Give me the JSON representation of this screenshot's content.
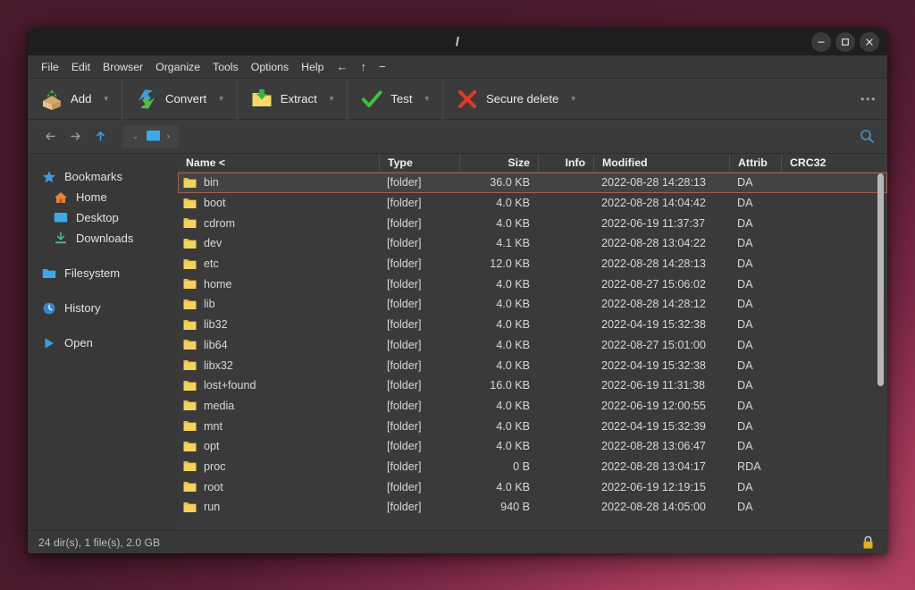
{
  "window": {
    "title": "/",
    "controls": [
      {
        "name": "minimize-button",
        "icon": "minimize-icon",
        "label": "Minimize"
      },
      {
        "name": "maximize-button",
        "icon": "maximize-icon",
        "label": "Maximize"
      },
      {
        "name": "close-button",
        "icon": "close-icon",
        "label": "Close"
      }
    ]
  },
  "menubar": {
    "items": [
      {
        "label": "File"
      },
      {
        "label": "Edit"
      },
      {
        "label": "Browser"
      },
      {
        "label": "Organize"
      },
      {
        "label": "Tools"
      },
      {
        "label": "Options"
      },
      {
        "label": "Help"
      }
    ],
    "icons": [
      {
        "name": "menu-back-icon",
        "glyph": "←"
      },
      {
        "name": "menu-up-icon",
        "glyph": "↑"
      },
      {
        "name": "menu-minus-icon",
        "glyph": "−"
      }
    ]
  },
  "toolbar": {
    "buttons": [
      {
        "label": "Add",
        "icon": "add-archive-icon",
        "caret": true
      },
      {
        "label": "Convert",
        "icon": "convert-icon",
        "caret": true
      },
      {
        "label": "Extract",
        "icon": "extract-folder-icon",
        "caret": true
      },
      {
        "label": "Test",
        "icon": "test-check-icon",
        "caret": true
      },
      {
        "label": "Secure delete",
        "icon": "secure-delete-icon",
        "caret": true
      }
    ],
    "overflow_label": "•••"
  },
  "navbar": {
    "back_label": "Back",
    "forward_label": "Forward",
    "up_label": "Up",
    "breadcrumb": {
      "caret": "⌄",
      "item_icon": "computer-icon",
      "separator": "›"
    },
    "search_label": "Search"
  },
  "sidebar": {
    "items": [
      {
        "label": "Bookmarks",
        "icon": "star-icon",
        "level": 0
      },
      {
        "label": "Home",
        "icon": "home-icon",
        "level": 1
      },
      {
        "label": "Desktop",
        "icon": "desktop-icon",
        "level": 1
      },
      {
        "label": "Downloads",
        "icon": "downloads-icon",
        "level": 1
      },
      {
        "label": "Filesystem",
        "icon": "folder-icon",
        "level": 0
      },
      {
        "label": "History",
        "icon": "history-clock-icon",
        "level": 0
      },
      {
        "label": "Open",
        "icon": "play-triangle-icon",
        "level": 0
      }
    ]
  },
  "filelist": {
    "columns": [
      {
        "key": "name",
        "label": "Name <",
        "align": "left"
      },
      {
        "key": "type",
        "label": "Type",
        "align": "left"
      },
      {
        "key": "size",
        "label": "Size",
        "align": "right"
      },
      {
        "key": "info",
        "label": "Info",
        "align": "right"
      },
      {
        "key": "modified",
        "label": "Modified",
        "align": "left"
      },
      {
        "key": "attrib",
        "label": "Attrib",
        "align": "left"
      },
      {
        "key": "crc32",
        "label": "CRC32",
        "align": "left"
      }
    ],
    "sort_column": "Name",
    "sort_indicator": "<",
    "rows": [
      {
        "name": "bin",
        "type": "[folder]",
        "size": "36.0 KB",
        "info": "",
        "modified": "2022-08-28 14:28:13",
        "attrib": "DA",
        "crc32": "",
        "selected": true
      },
      {
        "name": "boot",
        "type": "[folder]",
        "size": "4.0 KB",
        "info": "",
        "modified": "2022-08-28 14:04:42",
        "attrib": "DA",
        "crc32": "",
        "selected": false
      },
      {
        "name": "cdrom",
        "type": "[folder]",
        "size": "4.0 KB",
        "info": "",
        "modified": "2022-06-19 11:37:37",
        "attrib": "DA",
        "crc32": "",
        "selected": false
      },
      {
        "name": "dev",
        "type": "[folder]",
        "size": "4.1 KB",
        "info": "",
        "modified": "2022-08-28 13:04:22",
        "attrib": "DA",
        "crc32": "",
        "selected": false
      },
      {
        "name": "etc",
        "type": "[folder]",
        "size": "12.0 KB",
        "info": "",
        "modified": "2022-08-28 14:28:13",
        "attrib": "DA",
        "crc32": "",
        "selected": false
      },
      {
        "name": "home",
        "type": "[folder]",
        "size": "4.0 KB",
        "info": "",
        "modified": "2022-08-27 15:06:02",
        "attrib": "DA",
        "crc32": "",
        "selected": false
      },
      {
        "name": "lib",
        "type": "[folder]",
        "size": "4.0 KB",
        "info": "",
        "modified": "2022-08-28 14:28:12",
        "attrib": "DA",
        "crc32": "",
        "selected": false
      },
      {
        "name": "lib32",
        "type": "[folder]",
        "size": "4.0 KB",
        "info": "",
        "modified": "2022-04-19 15:32:38",
        "attrib": "DA",
        "crc32": "",
        "selected": false
      },
      {
        "name": "lib64",
        "type": "[folder]",
        "size": "4.0 KB",
        "info": "",
        "modified": "2022-08-27 15:01:00",
        "attrib": "DA",
        "crc32": "",
        "selected": false
      },
      {
        "name": "libx32",
        "type": "[folder]",
        "size": "4.0 KB",
        "info": "",
        "modified": "2022-04-19 15:32:38",
        "attrib": "DA",
        "crc32": "",
        "selected": false
      },
      {
        "name": "lost+found",
        "type": "[folder]",
        "size": "16.0 KB",
        "info": "",
        "modified": "2022-06-19 11:31:38",
        "attrib": "DA",
        "crc32": "",
        "selected": false
      },
      {
        "name": "media",
        "type": "[folder]",
        "size": "4.0 KB",
        "info": "",
        "modified": "2022-06-19 12:00:55",
        "attrib": "DA",
        "crc32": "",
        "selected": false
      },
      {
        "name": "mnt",
        "type": "[folder]",
        "size": "4.0 KB",
        "info": "",
        "modified": "2022-04-19 15:32:39",
        "attrib": "DA",
        "crc32": "",
        "selected": false
      },
      {
        "name": "opt",
        "type": "[folder]",
        "size": "4.0 KB",
        "info": "",
        "modified": "2022-08-28 13:06:47",
        "attrib": "DA",
        "crc32": "",
        "selected": false
      },
      {
        "name": "proc",
        "type": "[folder]",
        "size": "0 B",
        "info": "",
        "modified": "2022-08-28 13:04:17",
        "attrib": "RDA",
        "crc32": "",
        "selected": false
      },
      {
        "name": "root",
        "type": "[folder]",
        "size": "4.0 KB",
        "info": "",
        "modified": "2022-06-19 12:19:15",
        "attrib": "DA",
        "crc32": "",
        "selected": false
      },
      {
        "name": "run",
        "type": "[folder]",
        "size": "940 B",
        "info": "",
        "modified": "2022-08-28 14:05:00",
        "attrib": "DA",
        "crc32": "",
        "selected": false
      }
    ]
  },
  "statusbar": {
    "summary": "24 dir(s), 1 file(s), 2.0 GB",
    "lock_icon": "padlock-icon"
  },
  "colors": {
    "window_bg": "#383838",
    "titlebar_bg": "#1e1e1e",
    "selection_border": "#a2604a",
    "accent_blue": "#4fa3e3",
    "folder_yellow": "#f3cf52"
  }
}
